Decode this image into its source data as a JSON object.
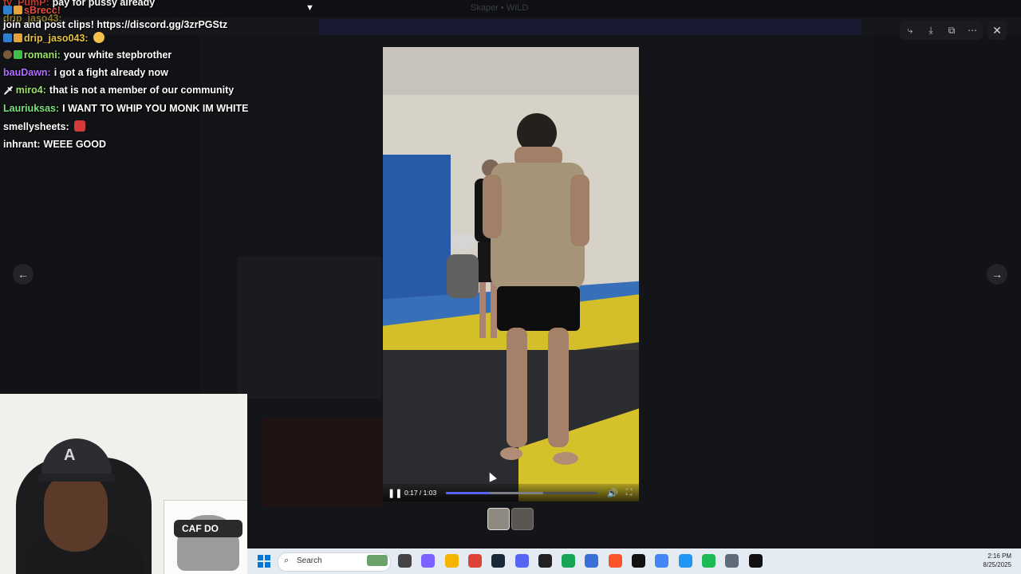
{
  "background": {
    "window_title": "Skaper • WILD"
  },
  "chat": [
    {
      "user": "ty_PumP:",
      "text": "pay for pussy already",
      "user_color": "#c0392b"
    },
    {
      "user": "",
      "text": "sBrecc!",
      "user_color": "#e74c3c"
    },
    {
      "user": "drip_jaso43:",
      "text": "",
      "user_color": "#e8c33a"
    },
    {
      "user": "",
      "text": "join and post clips! https://discord.gg/3zrPGStz",
      "user_color": "#ffffff"
    },
    {
      "user": "drip_jaso043:",
      "text": "",
      "user_color": "#e8c33a"
    },
    {
      "user": "romani:",
      "text": "your white stepbrother",
      "user_color": "#9be36a"
    },
    {
      "user": "bauDawn:",
      "text": "i got a fight already now",
      "user_color": "#b36bff"
    },
    {
      "user": "miro4:",
      "text": "that is not a member of our community",
      "user_color": "#9be36a"
    },
    {
      "user": "Lauriuksas:",
      "text": "I WANT TO WHIP YOU MONK IM WHITE",
      "user_color": "#7fe07f"
    },
    {
      "user": "smellysheets:",
      "text": "",
      "user_color": "#ffffff"
    },
    {
      "user": "inhrant:",
      "text": "WEEE GOOD",
      "user_color": "#ffffff"
    }
  ],
  "viewer": {
    "buttons": {
      "forward": "⤷",
      "download": "⤓",
      "open": "⧉",
      "more": "⋯"
    },
    "close": "✕",
    "prev": "←",
    "next": "→",
    "icons": [
      "share-icon",
      "download-icon",
      "open-external-icon",
      "more-icon"
    ]
  },
  "video": {
    "time": "0:17 / 1:03",
    "progress": 0.29,
    "buffered": 0.64,
    "play_glyph": "❚❚",
    "volume_glyph": "🔊",
    "fullscreen_glyph": "⛶"
  },
  "webcam": {
    "poster_text": "CAF DO"
  },
  "taskbar": {
    "search_placeholder": "Search",
    "time": "2:16 PM",
    "date": "8/25/2025",
    "app_colors": [
      "#444",
      "#7b61ff",
      "#f4b400",
      "#db4437",
      "#1b2838",
      "#5865f2",
      "#222",
      "#18a558",
      "#3a6fd8",
      "#fb542b",
      "#111",
      "#4285f4",
      "#2196f3",
      "#1db954",
      "#5f6b7a",
      "#111"
    ]
  },
  "colors": {
    "accent": "#5865f2"
  }
}
